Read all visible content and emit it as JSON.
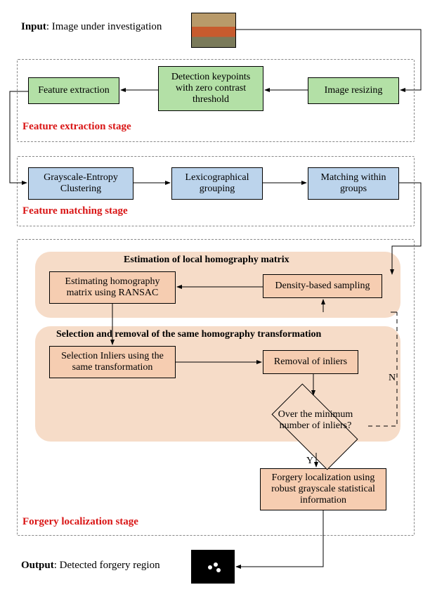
{
  "input": {
    "prefix": "Input",
    "text": ": Image under investigation"
  },
  "output": {
    "prefix": "Output",
    "text": ": Detected forgery region"
  },
  "stage1": {
    "title": "Feature extraction stage",
    "featx": "Feature extraction",
    "detk": "Detection keypoints with zero contrast threshold",
    "resize": "Image resizing"
  },
  "stage2": {
    "title": "Feature matching stage",
    "gec": "Grayscale-Entropy Clustering",
    "lex": "Lexicographical grouping",
    "match": "Matching within groups"
  },
  "stage3": {
    "title": "Forgery localization stage",
    "sub1_title": "Estimation of local homography matrix",
    "sub2_title": "Selection and removal of the same homography transformation",
    "homog": "Estimating homography matrix using RANSAC",
    "dens": "Density-based sampling",
    "selin": "Selection Inliers using the same transformation",
    "remin": "Removal of inliers",
    "decision": "Over the minimum number of inliers?",
    "forloc": "Forgery localization using robust grayscale statistical information",
    "N": "N",
    "Y": "Y"
  },
  "chart_data": {
    "type": "diagram",
    "title": "Forgery detection pipeline flowchart",
    "stages": [
      {
        "name": "Feature extraction stage",
        "color": "green",
        "nodes": [
          "Image resizing",
          "Detection keypoints with zero contrast threshold",
          "Feature extraction"
        ],
        "flow": [
          [
            "Image resizing",
            "Detection keypoints with zero contrast threshold"
          ],
          [
            "Detection keypoints with zero contrast threshold",
            "Feature extraction"
          ]
        ]
      },
      {
        "name": "Feature matching stage",
        "color": "blue",
        "nodes": [
          "Grayscale-Entropy Clustering",
          "Lexicographical grouping",
          "Matching within groups"
        ],
        "flow": [
          [
            "Grayscale-Entropy Clustering",
            "Lexicographical grouping"
          ],
          [
            "Lexicographical grouping",
            "Matching within groups"
          ]
        ]
      },
      {
        "name": "Forgery localization stage",
        "color": "orange",
        "subgroups": [
          {
            "name": "Estimation of local homography matrix",
            "nodes": [
              "Density-based sampling",
              "Estimating homography matrix using RANSAC"
            ]
          },
          {
            "name": "Selection and removal of the same homography transformation",
            "nodes": [
              "Selection Inliers using the same transformation",
              "Removal of inliers"
            ]
          }
        ],
        "decision": {
          "text": "Over the minimum number of inliers?",
          "yes": "Forgery localization using robust grayscale statistical information",
          "no": "loop back to Density-based sampling"
        },
        "final": "Forgery localization using robust grayscale statistical information"
      }
    ],
    "input": "Image under investigation",
    "output": "Detected forgery region"
  }
}
